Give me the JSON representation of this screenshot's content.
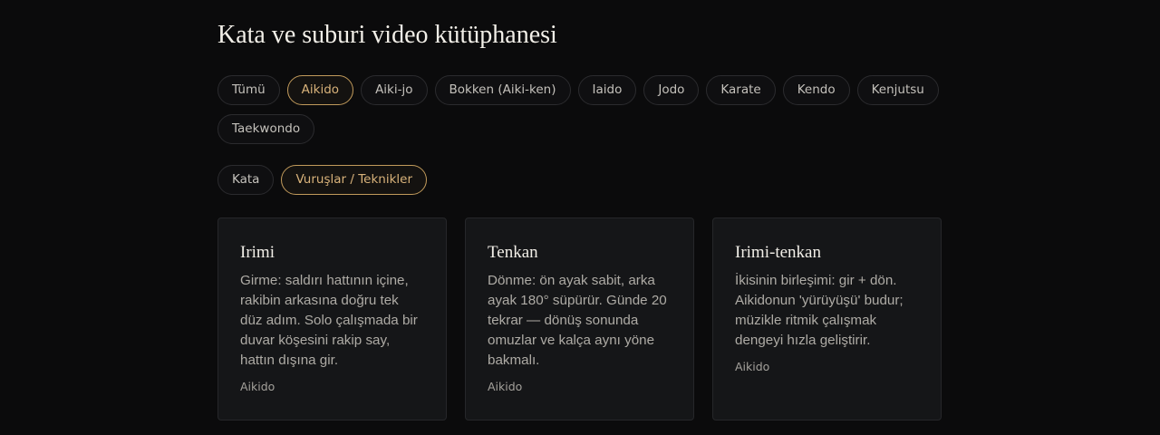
{
  "header": {
    "title": "Kata ve suburi video kütüphanesi"
  },
  "disciplines": [
    {
      "label": "Tümü",
      "active": false
    },
    {
      "label": "Aikido",
      "active": true
    },
    {
      "label": "Aiki-jo",
      "active": false
    },
    {
      "label": "Bokken (Aiki-ken)",
      "active": false
    },
    {
      "label": "Iaido",
      "active": false
    },
    {
      "label": "Jodo",
      "active": false
    },
    {
      "label": "Karate",
      "active": false
    },
    {
      "label": "Kendo",
      "active": false
    },
    {
      "label": "Kenjutsu",
      "active": false
    },
    {
      "label": "Taekwondo",
      "active": false
    }
  ],
  "types": [
    {
      "label": "Kata",
      "active": false
    },
    {
      "label": "Vuruşlar / Teknikler",
      "active": true
    }
  ],
  "cards": [
    {
      "title": "Irimi",
      "description": "Girme: saldırı hattının içine, rakibin arkasına doğru tek düz adım. Solo çalışmada bir duvar köşesini rakip say, hattın dışına gir.",
      "tag": "Aikido"
    },
    {
      "title": "Tenkan",
      "description": "Dönme: ön ayak sabit, arka ayak 180° süpürür. Günde 20 tekrar — dönüş sonunda omuzlar ve kalça aynı yöne bakmalı.",
      "tag": "Aikido"
    },
    {
      "title": "Irimi-tenkan",
      "description": "İkisinin birleşimi: gir + dön. Aikidonun 'yürüyüşü' budur; müzikle ritmik çalışmak dengeyi hızla geliştirir.",
      "tag": "Aikido"
    }
  ],
  "colors": {
    "background": "#0b0b0c",
    "card": "#151618",
    "accent": "#c19a5b",
    "accent_text": "#d8b27a"
  }
}
